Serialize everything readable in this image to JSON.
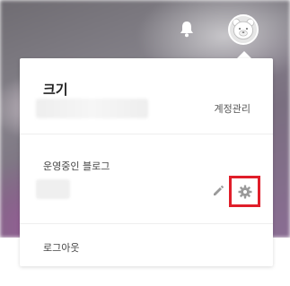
{
  "header": {
    "notification_icon": "bell-icon",
    "avatar_icon": "bear-avatar-icon"
  },
  "menu": {
    "user_name": "크기",
    "account_manage_label": "계정관리",
    "blog_section_title": "운영중인 블로그",
    "edit_icon": "pencil-icon",
    "settings_icon": "gear-icon",
    "highlight_color": "#e01e2a",
    "logout_label": "로그아웃"
  }
}
